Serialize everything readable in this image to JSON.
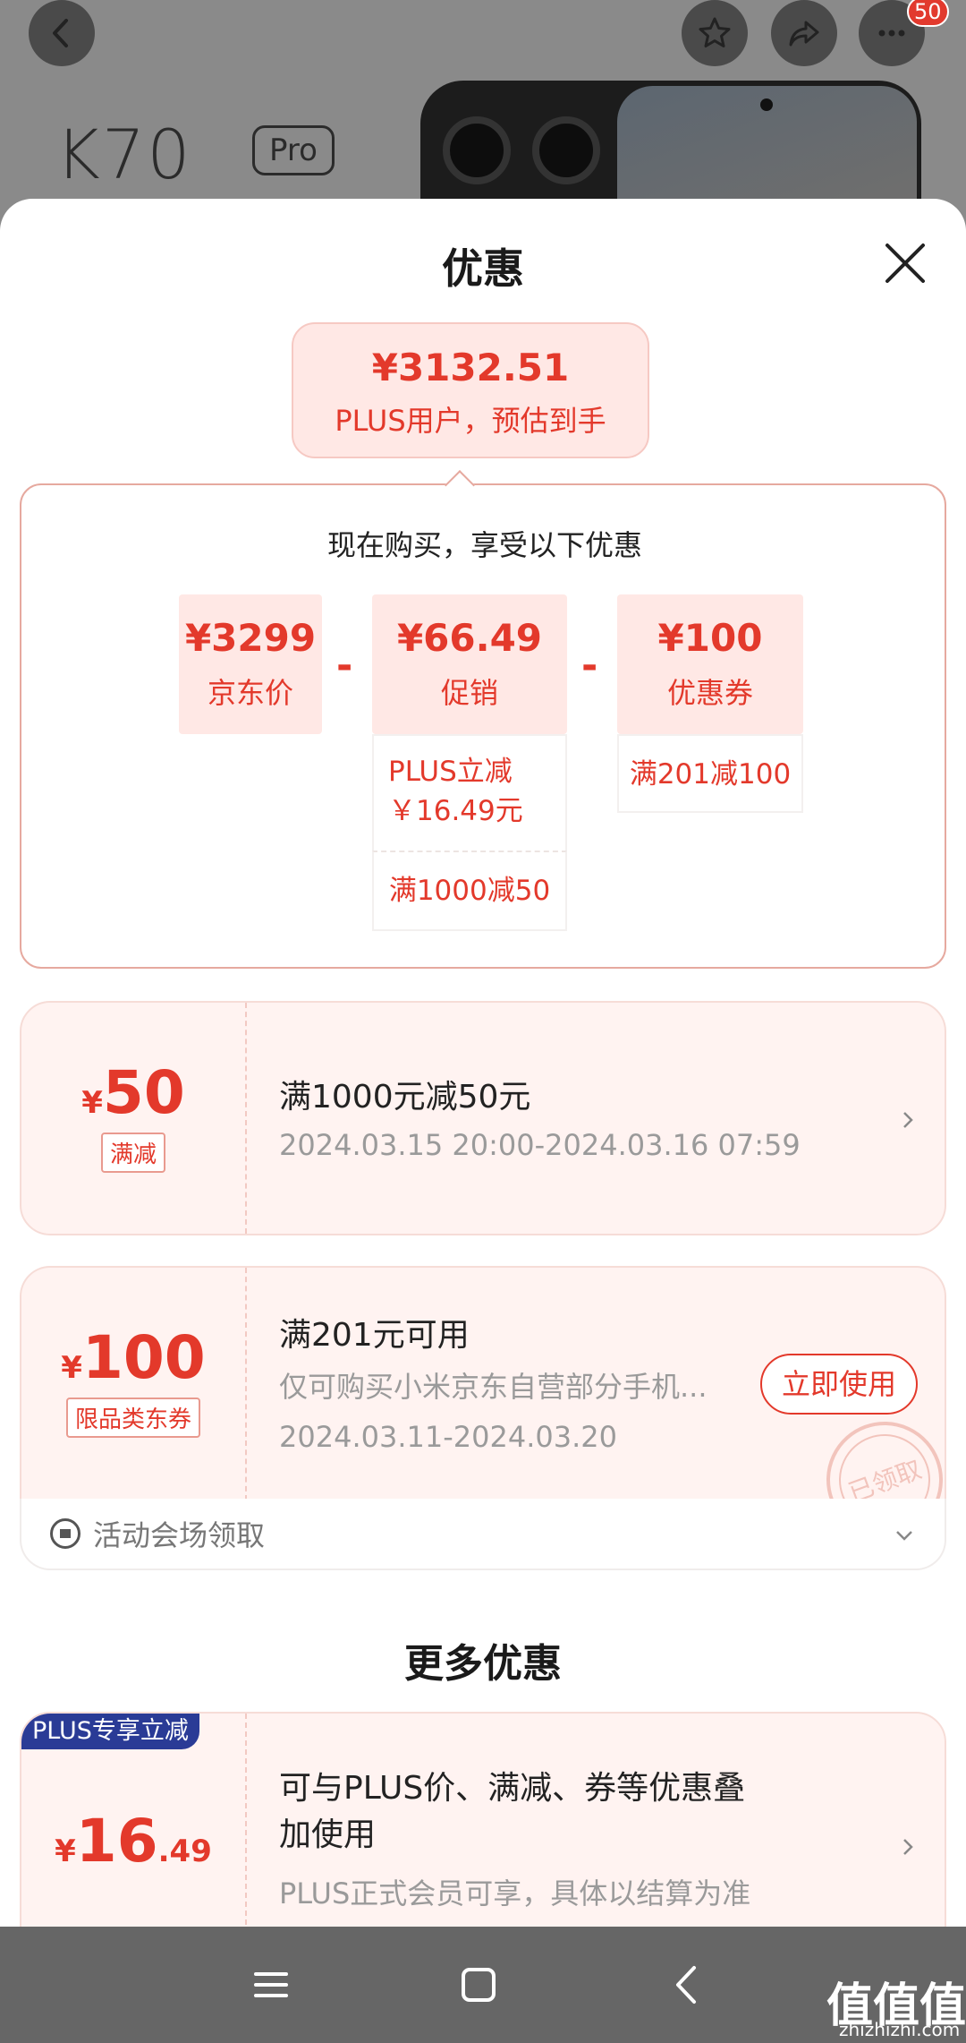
{
  "background": {
    "logo_main": "K70",
    "logo_suffix": "Pro",
    "more_badge": "50"
  },
  "sheet": {
    "title": "优惠",
    "estimate": {
      "price": "¥3132.51",
      "label": "PLUS用户，预估到手"
    },
    "breakdown": {
      "title": "现在购买，享受以下优惠",
      "minus": "-",
      "items": [
        {
          "value": "¥3299",
          "label": "京东价"
        },
        {
          "value": "¥66.49",
          "label": "促销",
          "details": [
            "PLUS立减\n￥16.49元",
            "满1000减50"
          ]
        },
        {
          "value": "¥100",
          "label": "优惠券",
          "details": [
            "满201减100"
          ]
        }
      ]
    },
    "coupons": [
      {
        "currency": "¥",
        "amount": "50",
        "tag": "满减",
        "title": "满1000元减50元",
        "period": "2024.03.15 20:00-2024.03.16 07:59"
      },
      {
        "currency": "¥",
        "amount": "100",
        "tag": "限品类东券",
        "title": "满201元可用",
        "desc": "仅可购买小米京东自营部分手机...",
        "period": "2024.03.11-2024.03.20",
        "action": "立即使用",
        "stamp": "已领取",
        "footer": "活动会场领取"
      }
    ],
    "more": {
      "title": "更多优惠",
      "item": {
        "badge": "PLUS专享立减",
        "currency": "¥",
        "amount_int": "16",
        "amount_dec": ".49",
        "title_line1": "可与PLUS价、满减、券等优惠叠",
        "title_line2": "加使用",
        "desc": "PLUS正式会员可享，具体以结算为准"
      }
    }
  },
  "watermark": {
    "main": "值值值",
    "sub": "zhizhizhi.com"
  },
  "colors": {
    "accent": "#e3392b",
    "plus_blue": "#2a3b96",
    "coupon_bg": "#fff3f1"
  }
}
